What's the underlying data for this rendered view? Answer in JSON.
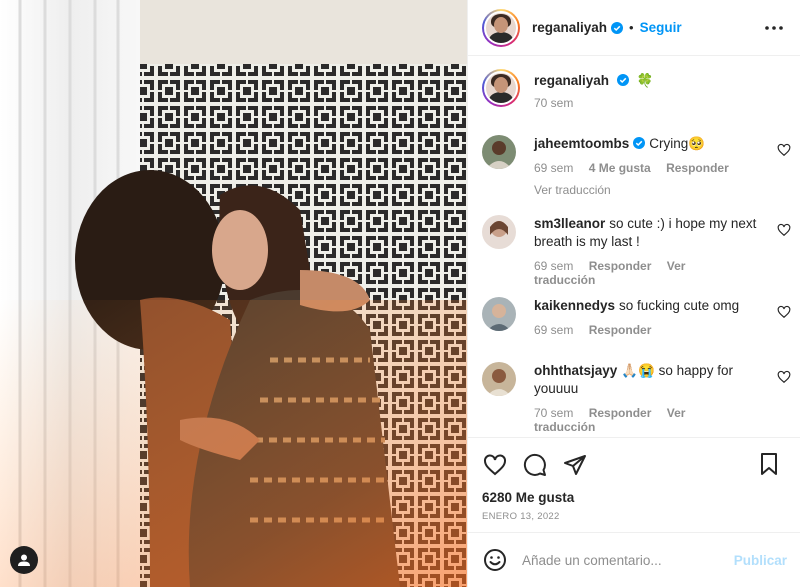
{
  "post": {
    "username": "reganaliyah",
    "follow_label": "Seguir",
    "caption_emoji": "🍀",
    "time_ago": "70 sem"
  },
  "comments": [
    {
      "user": "jaheemtoombs",
      "text": "Crying🥺",
      "time": "69 sem",
      "likes": "4 Me gusta",
      "reply": "Responder",
      "translate": "Ver traducción"
    },
    {
      "user": "sm3lleanor",
      "text": "so cute :) i hope my next breath is my last !",
      "time": "69 sem",
      "reply": "Responder",
      "translate": "Ver traducción"
    },
    {
      "user": "kaikennedys",
      "text": "so fucking cute omg",
      "time": "69 sem",
      "reply": "Responder"
    },
    {
      "user": "ohhthatsjayy",
      "text": "🙏🏻😭 so happy for youuuu",
      "time": "70 sem",
      "reply": "Responder",
      "translate": "Ver traducción"
    }
  ],
  "actions": {
    "likes": "6280 Me gusta",
    "date": "ENERO 13, 2022"
  },
  "comment_box": {
    "placeholder": "Añade un comentario...",
    "publish": "Publicar"
  },
  "icons": [
    "verified-badge-icon",
    "more-options-icon",
    "heart-icon",
    "comment-icon",
    "share-icon",
    "bookmark-icon",
    "emoji-icon",
    "user-icon"
  ],
  "colors": {
    "accent": "#0095f6",
    "publish_disabled": "#b2dffc",
    "muted": "#8e8e8e"
  }
}
